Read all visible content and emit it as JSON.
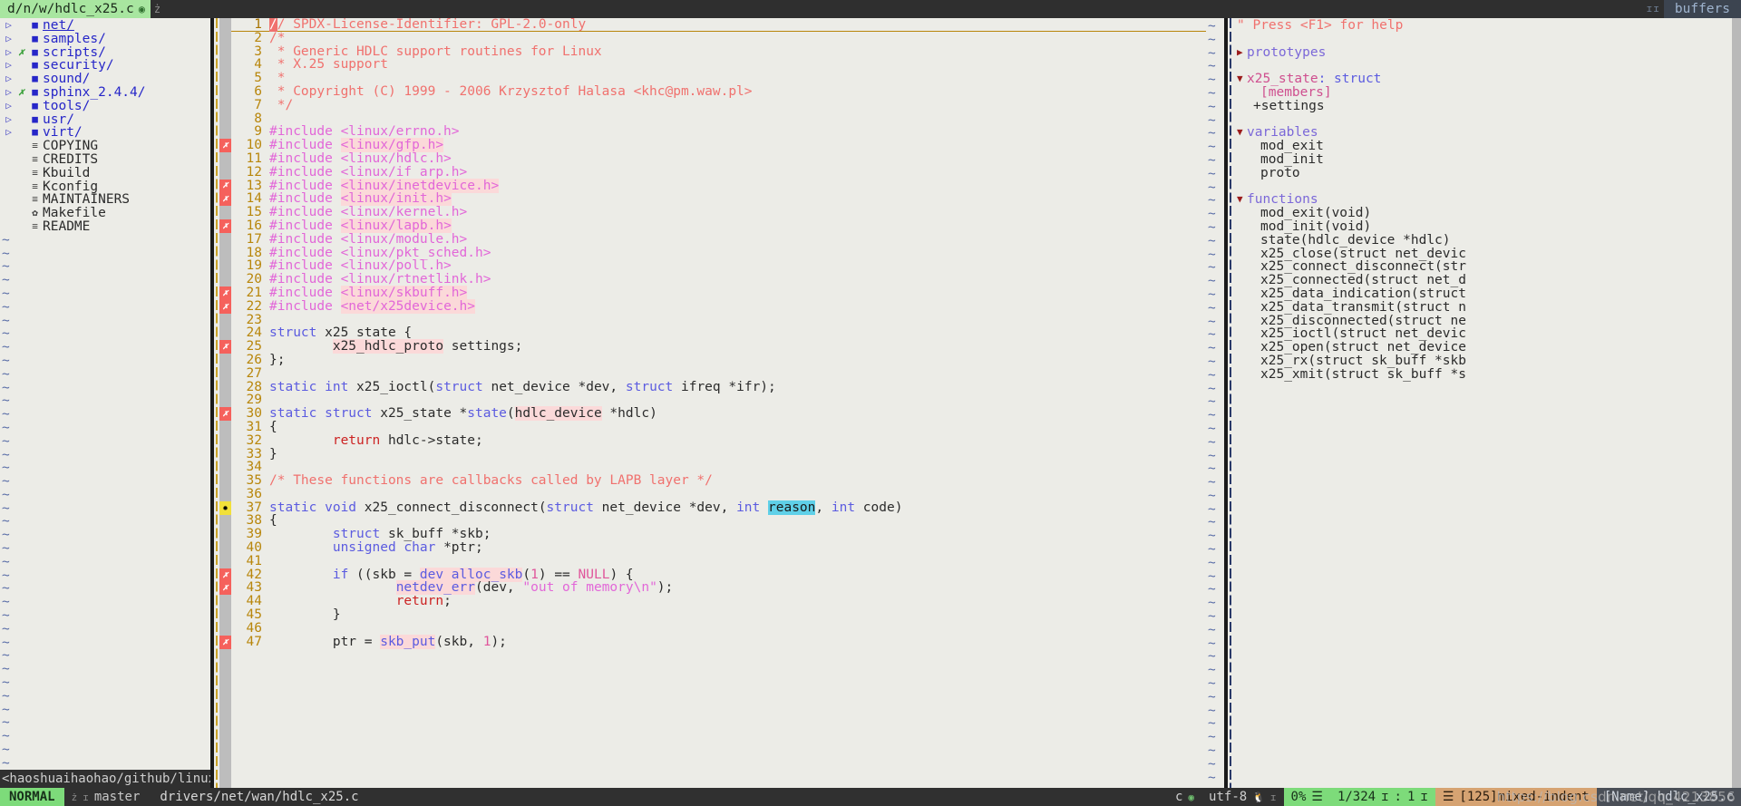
{
  "tabline": {
    "active_tab": "d/n/w/hdlc_x25.c",
    "modified_icon": "◉",
    "tab_sep": "ż",
    "buffer_icons": "ɪɪ",
    "buffers_label": "buffers"
  },
  "filetree": {
    "items": [
      {
        "arrow": "▷",
        "flag": "",
        "icon": "dir",
        "label": "net/",
        "type": "dir",
        "first": true
      },
      {
        "arrow": "▷",
        "flag": "",
        "icon": "dir",
        "label": "samples/",
        "type": "dir"
      },
      {
        "arrow": "▷",
        "flag": "✗",
        "icon": "dir",
        "label": "scripts/",
        "type": "dir"
      },
      {
        "arrow": "▷",
        "flag": "",
        "icon": "dir",
        "label": "security/",
        "type": "dir"
      },
      {
        "arrow": "▷",
        "flag": "",
        "icon": "dir",
        "label": "sound/",
        "type": "dir"
      },
      {
        "arrow": "▷",
        "flag": "✗",
        "icon": "dir",
        "label": "sphinx_2.4.4/",
        "type": "dir"
      },
      {
        "arrow": "▷",
        "flag": "",
        "icon": "dir",
        "label": "tools/",
        "type": "dir"
      },
      {
        "arrow": "▷",
        "flag": "",
        "icon": "dir",
        "label": "usr/",
        "type": "dir"
      },
      {
        "arrow": "▷",
        "flag": "",
        "icon": "dir",
        "label": "virt/",
        "type": "dir"
      },
      {
        "arrow": "",
        "flag": "",
        "icon": "file",
        "label": "COPYING",
        "type": "file"
      },
      {
        "arrow": "",
        "flag": "",
        "icon": "file",
        "label": "CREDITS",
        "type": "file"
      },
      {
        "arrow": "",
        "flag": "",
        "icon": "file",
        "label": "Kbuild",
        "type": "file"
      },
      {
        "arrow": "",
        "flag": "",
        "icon": "file",
        "label": "Kconfig",
        "type": "file"
      },
      {
        "arrow": "",
        "flag": "",
        "icon": "file",
        "label": "MAINTAINERS",
        "type": "file"
      },
      {
        "arrow": "",
        "flag": "",
        "icon": "gear",
        "label": "Makefile",
        "type": "file"
      },
      {
        "arrow": "",
        "flag": "",
        "icon": "file",
        "label": "README",
        "type": "file"
      }
    ],
    "status": "<haoshuaihaohao/github/linux",
    "status_git_icon": "ż"
  },
  "editor": {
    "lines": [
      {
        "n": 1,
        "sign": "",
        "cursor": true,
        "tokens": [
          {
            "t": "/",
            "c": "hl-cursor"
          },
          {
            "t": "/ SPDX-License-Identifier: GPL-2.0-only",
            "c": "c-cmt"
          }
        ]
      },
      {
        "n": 2,
        "sign": "",
        "tokens": [
          {
            "t": "/*",
            "c": "c-cmt"
          }
        ]
      },
      {
        "n": 3,
        "sign": "",
        "tokens": [
          {
            "t": " * Generic HDLC support routines for Linux",
            "c": "c-cmt"
          }
        ]
      },
      {
        "n": 4,
        "sign": "",
        "tokens": [
          {
            "t": " * X.25 support",
            "c": "c-cmt"
          }
        ]
      },
      {
        "n": 5,
        "sign": "",
        "tokens": [
          {
            "t": " *",
            "c": "c-cmt"
          }
        ]
      },
      {
        "n": 6,
        "sign": "",
        "tokens": [
          {
            "t": " * Copyright (C) 1999 - 2006 Krzysztof Halasa <khc@pm.waw.pl>",
            "c": "c-cmt"
          }
        ]
      },
      {
        "n": 7,
        "sign": "",
        "tokens": [
          {
            "t": " */",
            "c": "c-cmt"
          }
        ]
      },
      {
        "n": 8,
        "sign": "",
        "tokens": []
      },
      {
        "n": 9,
        "sign": "",
        "tokens": [
          {
            "t": "#include <linux/errno.h>",
            "c": "c-pre"
          }
        ]
      },
      {
        "n": 10,
        "sign": "err",
        "tokens": [
          {
            "t": "#include ",
            "c": "c-pre"
          },
          {
            "t": "<linux/gfp.h>",
            "c": "c-pre hl"
          }
        ]
      },
      {
        "n": 11,
        "sign": "",
        "tokens": [
          {
            "t": "#include <linux/hdlc.h>",
            "c": "c-pre"
          }
        ]
      },
      {
        "n": 12,
        "sign": "",
        "tokens": [
          {
            "t": "#include <linux/if_arp.h>",
            "c": "c-pre"
          }
        ]
      },
      {
        "n": 13,
        "sign": "err",
        "tokens": [
          {
            "t": "#include ",
            "c": "c-pre"
          },
          {
            "t": "<linux/inetdevice.h>",
            "c": "c-pre hl"
          }
        ]
      },
      {
        "n": 14,
        "sign": "err",
        "tokens": [
          {
            "t": "#include ",
            "c": "c-pre"
          },
          {
            "t": "<linux/init.h>",
            "c": "c-pre hl"
          }
        ]
      },
      {
        "n": 15,
        "sign": "",
        "tokens": [
          {
            "t": "#include <linux/kernel.h>",
            "c": "c-pre"
          }
        ]
      },
      {
        "n": 16,
        "sign": "err",
        "tokens": [
          {
            "t": "#include ",
            "c": "c-pre"
          },
          {
            "t": "<linux/lapb.h>",
            "c": "c-pre hl"
          }
        ]
      },
      {
        "n": 17,
        "sign": "",
        "tokens": [
          {
            "t": "#include <linux/module.h>",
            "c": "c-pre"
          }
        ]
      },
      {
        "n": 18,
        "sign": "",
        "tokens": [
          {
            "t": "#include <linux/pkt_sched.h>",
            "c": "c-pre"
          }
        ]
      },
      {
        "n": 19,
        "sign": "",
        "tokens": [
          {
            "t": "#include <linux/poll.h>",
            "c": "c-pre"
          }
        ]
      },
      {
        "n": 20,
        "sign": "",
        "tokens": [
          {
            "t": "#include <linux/rtnetlink.h>",
            "c": "c-pre"
          }
        ]
      },
      {
        "n": 21,
        "sign": "err",
        "tokens": [
          {
            "t": "#include ",
            "c": "c-pre"
          },
          {
            "t": "<linux/skbuff.h>",
            "c": "c-pre hl"
          }
        ]
      },
      {
        "n": 22,
        "sign": "err",
        "tokens": [
          {
            "t": "#include ",
            "c": "c-pre"
          },
          {
            "t": "<net/x25device.h>",
            "c": "c-pre hl"
          }
        ]
      },
      {
        "n": 23,
        "sign": "",
        "tokens": []
      },
      {
        "n": 24,
        "sign": "",
        "tokens": [
          {
            "t": "struct",
            "c": "c-kw"
          },
          {
            "t": " x25_state {",
            "c": "c-id"
          }
        ]
      },
      {
        "n": 25,
        "sign": "err",
        "tokens": [
          {
            "t": "        ",
            "c": "c-id"
          },
          {
            "t": "x25_hdlc_proto",
            "c": "c-id hl"
          },
          {
            "t": " settings;",
            "c": "c-id"
          }
        ]
      },
      {
        "n": 26,
        "sign": "",
        "tokens": [
          {
            "t": "};",
            "c": "c-id"
          }
        ]
      },
      {
        "n": 27,
        "sign": "",
        "tokens": []
      },
      {
        "n": 28,
        "sign": "",
        "tokens": [
          {
            "t": "static int",
            "c": "c-kw"
          },
          {
            "t": " x25_ioctl(",
            "c": "c-id"
          },
          {
            "t": "struct",
            "c": "c-kw"
          },
          {
            "t": " net_device *dev, ",
            "c": "c-id"
          },
          {
            "t": "struct",
            "c": "c-kw"
          },
          {
            "t": " ifreq *ifr);",
            "c": "c-id"
          }
        ]
      },
      {
        "n": 29,
        "sign": "",
        "tokens": []
      },
      {
        "n": 30,
        "sign": "err",
        "tokens": [
          {
            "t": "static struct",
            "c": "c-kw"
          },
          {
            "t": " x25_state *",
            "c": "c-id"
          },
          {
            "t": "state",
            "c": "c-fn"
          },
          {
            "t": "(",
            "c": "c-id"
          },
          {
            "t": "hdlc_device",
            "c": "c-id hl"
          },
          {
            "t": " *hdlc)",
            "c": "c-id"
          }
        ]
      },
      {
        "n": 31,
        "sign": "",
        "tokens": [
          {
            "t": "{",
            "c": "c-id"
          }
        ]
      },
      {
        "n": 32,
        "sign": "",
        "tokens": [
          {
            "t": "        ",
            "c": "c-id"
          },
          {
            "t": "return",
            "c": "c-ret"
          },
          {
            "t": " hdlc->state;",
            "c": "c-id"
          }
        ]
      },
      {
        "n": 33,
        "sign": "",
        "tokens": [
          {
            "t": "}",
            "c": "c-id"
          }
        ]
      },
      {
        "n": 34,
        "sign": "",
        "tokens": []
      },
      {
        "n": 35,
        "sign": "",
        "tokens": [
          {
            "t": "/* These functions are callbacks called by LAPB layer */",
            "c": "c-cmt"
          }
        ]
      },
      {
        "n": 36,
        "sign": "",
        "tokens": []
      },
      {
        "n": 37,
        "sign": "bp",
        "tokens": [
          {
            "t": "static void",
            "c": "c-kw"
          },
          {
            "t": " x25_connect_disconnect(",
            "c": "c-id"
          },
          {
            "t": "struct",
            "c": "c-kw"
          },
          {
            "t": " net_device *dev, ",
            "c": "c-id"
          },
          {
            "t": "int",
            "c": "c-kw"
          },
          {
            "t": " ",
            "c": "c-id"
          },
          {
            "t": "reason",
            "c": "hl-sel"
          },
          {
            "t": ", ",
            "c": "c-id"
          },
          {
            "t": "int",
            "c": "c-kw"
          },
          {
            "t": " code)",
            "c": "c-id"
          }
        ]
      },
      {
        "n": 38,
        "sign": "",
        "tokens": [
          {
            "t": "{",
            "c": "c-id"
          }
        ]
      },
      {
        "n": 39,
        "sign": "",
        "tokens": [
          {
            "t": "        ",
            "c": "c-id"
          },
          {
            "t": "struct",
            "c": "c-kw"
          },
          {
            "t": " sk_buff *skb;",
            "c": "c-id"
          }
        ]
      },
      {
        "n": 40,
        "sign": "",
        "tokens": [
          {
            "t": "        ",
            "c": "c-id"
          },
          {
            "t": "unsigned char",
            "c": "c-kw"
          },
          {
            "t": " *ptr;",
            "c": "c-id"
          }
        ]
      },
      {
        "n": 41,
        "sign": "",
        "tokens": []
      },
      {
        "n": 42,
        "sign": "err",
        "tokens": [
          {
            "t": "        ",
            "c": "c-id"
          },
          {
            "t": "if",
            "c": "c-kw"
          },
          {
            "t": " ((skb = ",
            "c": "c-id"
          },
          {
            "t": "dev_alloc_skb",
            "c": "c-fn hl"
          },
          {
            "t": "(",
            "c": "c-id"
          },
          {
            "t": "1",
            "c": "c-num"
          },
          {
            "t": ") == ",
            "c": "c-id"
          },
          {
            "t": "NULL",
            "c": "c-nul"
          },
          {
            "t": ") {",
            "c": "c-id"
          }
        ]
      },
      {
        "n": 43,
        "sign": "err",
        "tokens": [
          {
            "t": "                ",
            "c": "c-id"
          },
          {
            "t": "netdev_err",
            "c": "c-fn hl"
          },
          {
            "t": "(dev, ",
            "c": "c-id"
          },
          {
            "t": "\"out of memory\\n\"",
            "c": "c-str"
          },
          {
            "t": ");",
            "c": "c-id"
          }
        ]
      },
      {
        "n": 44,
        "sign": "",
        "tokens": [
          {
            "t": "                ",
            "c": "c-id"
          },
          {
            "t": "return",
            "c": "c-ret"
          },
          {
            "t": ";",
            "c": "c-id"
          }
        ]
      },
      {
        "n": 45,
        "sign": "",
        "tokens": [
          {
            "t": "        }",
            "c": "c-id"
          }
        ]
      },
      {
        "n": 46,
        "sign": "",
        "tokens": []
      },
      {
        "n": 47,
        "sign": "err",
        "tokens": [
          {
            "t": "        ptr = ",
            "c": "c-id"
          },
          {
            "t": "skb_put",
            "c": "c-fn hl"
          },
          {
            "t": "(skb, ",
            "c": "c-id"
          },
          {
            "t": "1",
            "c": "c-num"
          },
          {
            "t": ");",
            "c": "c-id"
          }
        ]
      }
    ]
  },
  "tagbar": {
    "help": "\" Press <F1> for help",
    "rows": [
      {
        "kind": "help",
        "text": "\" Press <F1> for help"
      },
      {
        "kind": "blank",
        "text": ""
      },
      {
        "kind": "fold",
        "arrow": "▶",
        "text": "prototypes"
      },
      {
        "kind": "blank",
        "text": ""
      },
      {
        "kind": "scope",
        "arrow": "▼",
        "text": "x25_state",
        "sep": " : ",
        "meta": "struct"
      },
      {
        "kind": "member",
        "text": "[members]"
      },
      {
        "kind": "item-m",
        "text": "+settings"
      },
      {
        "kind": "blank",
        "text": ""
      },
      {
        "kind": "fold",
        "arrow": "▼",
        "text": "variables"
      },
      {
        "kind": "item",
        "text": "mod_exit"
      },
      {
        "kind": "item",
        "text": "mod_init"
      },
      {
        "kind": "item",
        "text": "proto"
      },
      {
        "kind": "blank",
        "text": ""
      },
      {
        "kind": "fold",
        "arrow": "▼",
        "text": "functions"
      },
      {
        "kind": "item",
        "text": "mod_exit(void)"
      },
      {
        "kind": "item",
        "text": "mod_init(void)"
      },
      {
        "kind": "item",
        "text": "state(hdlc_device *hdlc)"
      },
      {
        "kind": "item",
        "text": "x25_close(struct net_devic"
      },
      {
        "kind": "item",
        "text": "x25_connect_disconnect(str"
      },
      {
        "kind": "item",
        "text": "x25_connected(struct net_d"
      },
      {
        "kind": "item",
        "text": "x25_data_indication(struct"
      },
      {
        "kind": "item",
        "text": "x25_data_transmit(struct n"
      },
      {
        "kind": "item",
        "text": "x25_disconnected(struct ne"
      },
      {
        "kind": "item",
        "text": "x25_ioctl(struct net_devic"
      },
      {
        "kind": "item",
        "text": "x25_open(struct net_device"
      },
      {
        "kind": "item",
        "text": "x25_rx(struct sk_buff *skb"
      },
      {
        "kind": "item",
        "text": "x25_xmit(struct sk_buff *s"
      }
    ]
  },
  "statusline": {
    "tree_status": "<haoshuaihaohao/github/linux",
    "tree_git_icon": "ż",
    "mode": "NORMAL",
    "git_icon": "ż",
    "branch_icon": "ɪ",
    "branch": "master",
    "path": "drivers/net/wan/hdlc_x25.c",
    "filetype": "c",
    "filetype_icon": "◉",
    "encoding": "utf-8",
    "os_icon": "🐧",
    "fileformat_icon": "ɪ",
    "percent": "0%",
    "percent_icon": "☰",
    "position": "1/324",
    "pos_icon": "ɪ",
    "colon": ":",
    "column": "1",
    "col_icon": "ɪ",
    "warn_icon": "☰",
    "warning": "[125]mixed-indent",
    "buffer_name": "[Name] hdlc_x25.c"
  },
  "watermark": "https://blog.csdn.net/qq_4213856",
  "colors": {
    "bg": "#ecece7",
    "tabline_bg": "#2f2f2f",
    "tab_active_bg": "#a8e6a0",
    "statusline_bg": "#303030",
    "mode_bg": "#7ddb7a",
    "warn_bg": "#d6a372",
    "error_sign": "#f5615c",
    "breakpoint_sign": "#f2e03a",
    "highlight": "#fbd9d9",
    "selection": "#5fd0e8",
    "comment": "#f0716e",
    "preproc": "#e267d8",
    "keyword": "#5b5be0",
    "linenumber": "#b8860b"
  }
}
